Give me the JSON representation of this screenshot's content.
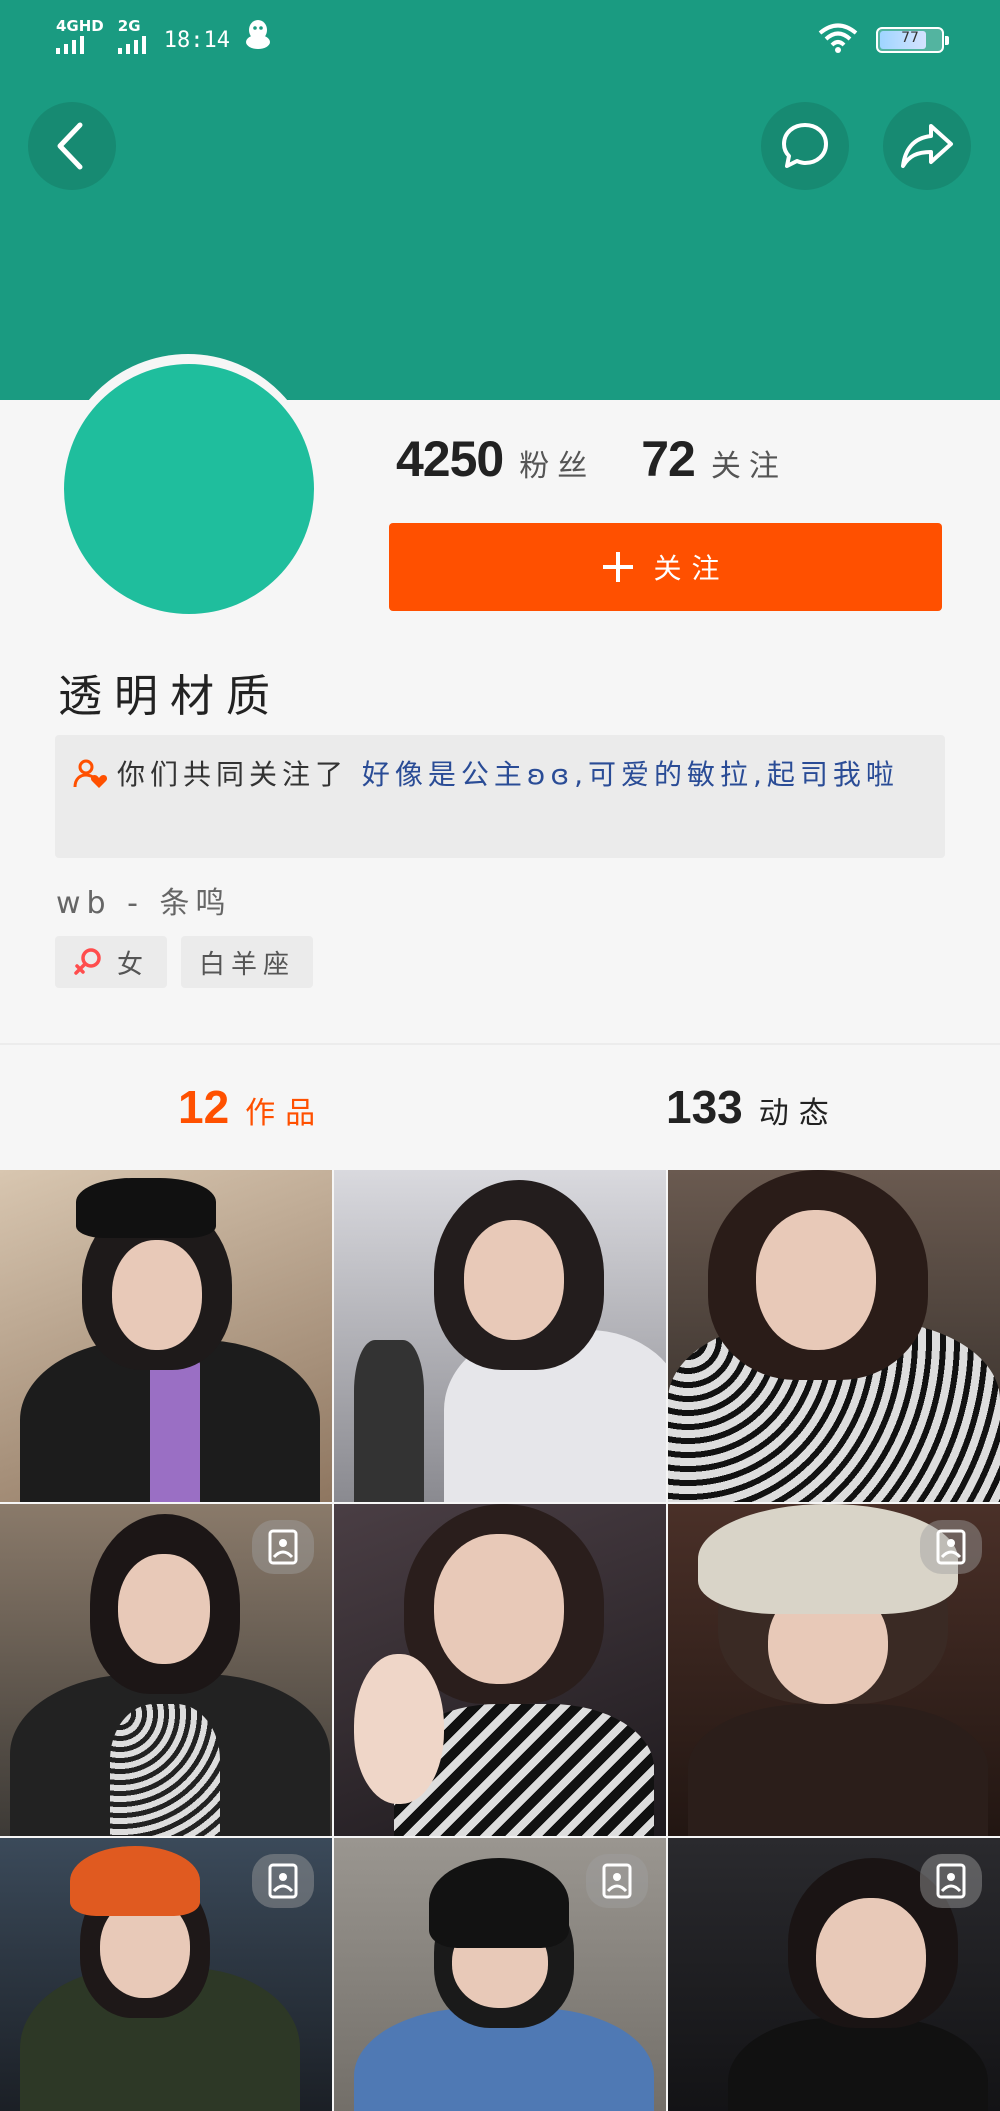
{
  "status_bar": {
    "net1": "4GHD",
    "net2": "2G",
    "time": "18:14",
    "battery_level": "77",
    "wifi_icon": "wifi-icon",
    "qq_icon": "qq-penguin-icon"
  },
  "header": {
    "back_icon": "chevron-left-icon",
    "message_icon": "chat-bubble-icon",
    "share_icon": "share-arrow-icon",
    "color": "#1a9b81"
  },
  "profile": {
    "followers_count": "4250",
    "followers_label": "粉丝",
    "following_count": "72",
    "following_label": "关注",
    "follow_button_label": "关注",
    "username": "透明材质",
    "mutual_prefix": "你们共同关注了",
    "mutual_names": "好像是公主ʚɞ,可爱的敏拉,起司我啦",
    "bio": "wb - 条鸣",
    "tags": [
      {
        "icon": "female-icon",
        "label": "女"
      },
      {
        "label": "白羊座"
      }
    ],
    "accent_color": "#ff5000"
  },
  "tabs": {
    "works_count": "12",
    "works_label": "作品",
    "posts_count": "133",
    "posts_label": "动态"
  },
  "grid": {
    "badge_icon": "image-post-icon",
    "items": [
      {
        "has_badge": false
      },
      {
        "has_badge": false
      },
      {
        "has_badge": false
      },
      {
        "has_badge": true
      },
      {
        "has_badge": false
      },
      {
        "has_badge": true
      },
      {
        "has_badge": true
      },
      {
        "has_badge": true
      },
      {
        "has_badge": true
      }
    ]
  }
}
